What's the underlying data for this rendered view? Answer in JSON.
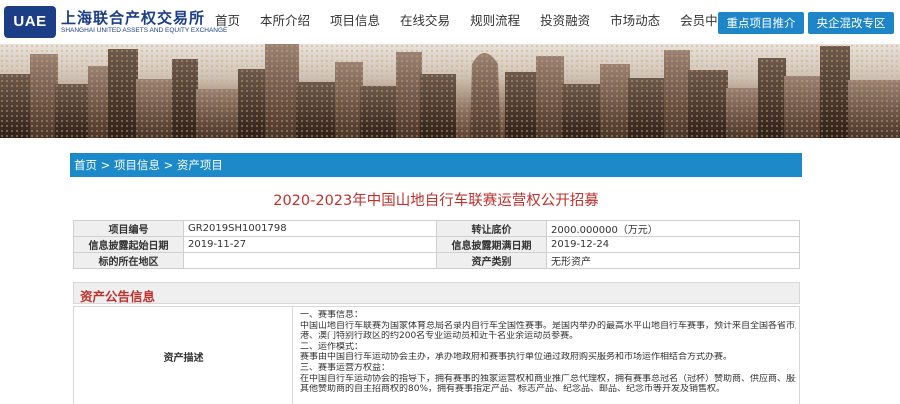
{
  "header": {
    "logo_mark": "UAE",
    "logo_cn": "上海联合产权交易所",
    "logo_en": "SHANGHAI UNITED ASSETS AND EQUITY EXCHANGE",
    "nav": [
      "首页",
      "本所介绍",
      "项目信息",
      "在线交易",
      "规则流程",
      "投资融资",
      "市场动态",
      "会员中心"
    ],
    "buttons": [
      "重点项目推介",
      "央企混改专区"
    ]
  },
  "breadcrumb": [
    "首页",
    "项目信息",
    "资产项目"
  ],
  "page_title": "2020-2023年中国山地自行车联赛运营权公开招募",
  "info_rows": [
    {
      "k1": "项目编号",
      "v1": "GR2019SH1001798",
      "k2": "转让底价",
      "v2": "2000.000000（万元）"
    },
    {
      "k1": "信息披露起始日期",
      "v1": "2019-11-27",
      "k2": "信息披露期满日期",
      "v2": "2019-12-24"
    },
    {
      "k1": "标的所在地区",
      "v1": "",
      "k2": "资产类别",
      "v2": "无形资产"
    }
  ],
  "announcement": {
    "heading": "资产公告信息",
    "key": "资产描述",
    "lines": [
      "一、赛事信息：",
      "中国山地自行车联赛为国家体育总局名录内自行车全国性赛事。是国内举办的最高水平山地自行车赛事，预计来自全国各省市及香",
      "港、澳门特别行政区的约200名专业运动员和近千名业余运动员参赛。",
      "二、运作模式：",
      "赛事由中国自行车运动协会主办，承办地政府和赛事执行单位通过政府购买服务和市场运作相结合方式办赛。",
      "三、赛事运营方权益：",
      "在中国自行车运动协会的指导下，拥有赛事的独家运营权和商业推广总代理权，拥有赛事总冠名（冠杯）赞助商、供应商、服务商",
      "其他赞助商的自主招商权的80%，拥有赛事指定产品、标志产品、纪念品、邮品、纪念币等开发及销售权。"
    ]
  },
  "colors": {
    "brand": "#1b3e86",
    "accent": "#1c8ac9",
    "title_red": "#c0302c"
  }
}
